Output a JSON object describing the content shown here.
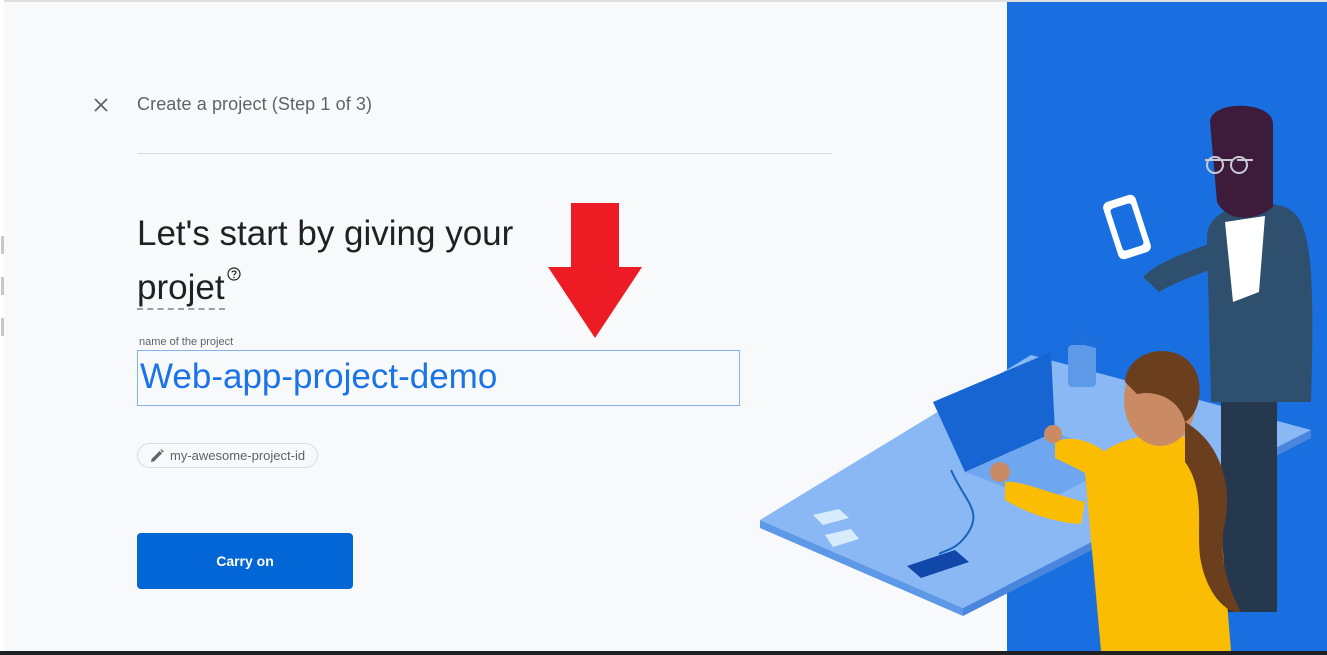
{
  "dialog": {
    "step_title": "Create a project (Step 1 of 3)",
    "headline_line1": "Let's start by giving your",
    "headline_line2": "projet",
    "close_icon": "close-icon",
    "help_icon": "help-circle-icon"
  },
  "form": {
    "name_label": "name of the project",
    "name_value": "Web-app-project-demo",
    "project_id": "my-awesome-project-id",
    "edit_icon": "pencil-icon",
    "continue_label": "Carry on"
  },
  "annotation": {
    "arrow_color": "#ed1c24"
  },
  "colors": {
    "primary": "#0366d6",
    "illustration_blue": "#1a6fe0",
    "input_text": "#1a73e8"
  }
}
